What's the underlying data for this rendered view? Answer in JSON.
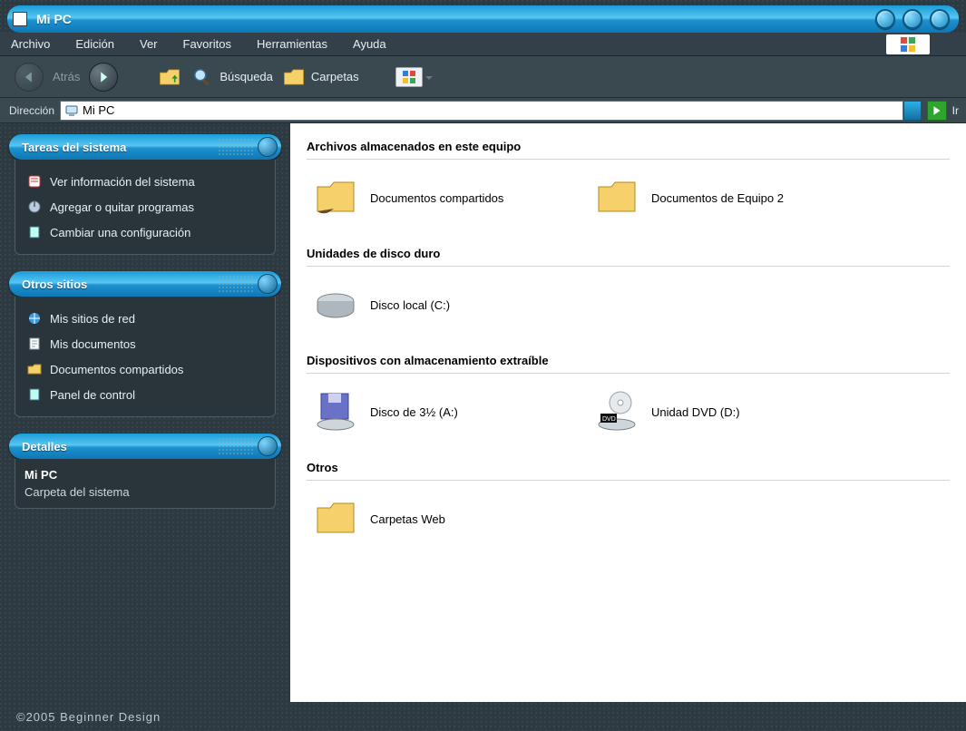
{
  "window_title": "Mi PC",
  "menus": [
    "Archivo",
    "Edición",
    "Ver",
    "Favoritos",
    "Herramientas",
    "Ayuda"
  ],
  "toolbar": {
    "back_label": "Atrás",
    "search_label": "Búsqueda",
    "folders_label": "Carpetas"
  },
  "address": {
    "label": "Dirección",
    "value": "Mi PC",
    "go_label": "Ir"
  },
  "sidebar": {
    "panels": [
      {
        "title": "Tareas del sistema",
        "items": [
          {
            "icon": "info",
            "label": "Ver información del sistema"
          },
          {
            "icon": "disk",
            "label": "Agregar o quitar programas"
          },
          {
            "icon": "note",
            "label": "Cambiar una configuración"
          }
        ]
      },
      {
        "title": "Otros sitios",
        "items": [
          {
            "icon": "net",
            "label": "Mis sitios de red"
          },
          {
            "icon": "docs",
            "label": "Mis documentos"
          },
          {
            "icon": "folder",
            "label": "Documentos compartidos"
          },
          {
            "icon": "note",
            "label": "Panel de control"
          }
        ]
      },
      {
        "title": "Detalles",
        "details": {
          "name": "Mi PC",
          "sub": "Carpeta del sistema"
        }
      }
    ]
  },
  "content": {
    "sections": [
      {
        "title": "Archivos almacenados en este equipo",
        "items": [
          {
            "icon": "shared-folder",
            "label": "Documentos compartidos"
          },
          {
            "icon": "folder",
            "label": "Documentos de Equipo 2"
          }
        ]
      },
      {
        "title": "Unidades de disco duro",
        "items": [
          {
            "icon": "hdd",
            "label": "Disco local (C:)"
          }
        ]
      },
      {
        "title": "Dispositivos con almacenamiento extraíble",
        "items": [
          {
            "icon": "floppy",
            "label": "Disco de 3½ (A:)"
          },
          {
            "icon": "dvd",
            "label": "Unidad DVD (D:)"
          }
        ]
      },
      {
        "title": "Otros",
        "items": [
          {
            "icon": "folder",
            "label": "Carpetas Web"
          }
        ]
      }
    ]
  },
  "footer": "©2005 Beginner Design"
}
